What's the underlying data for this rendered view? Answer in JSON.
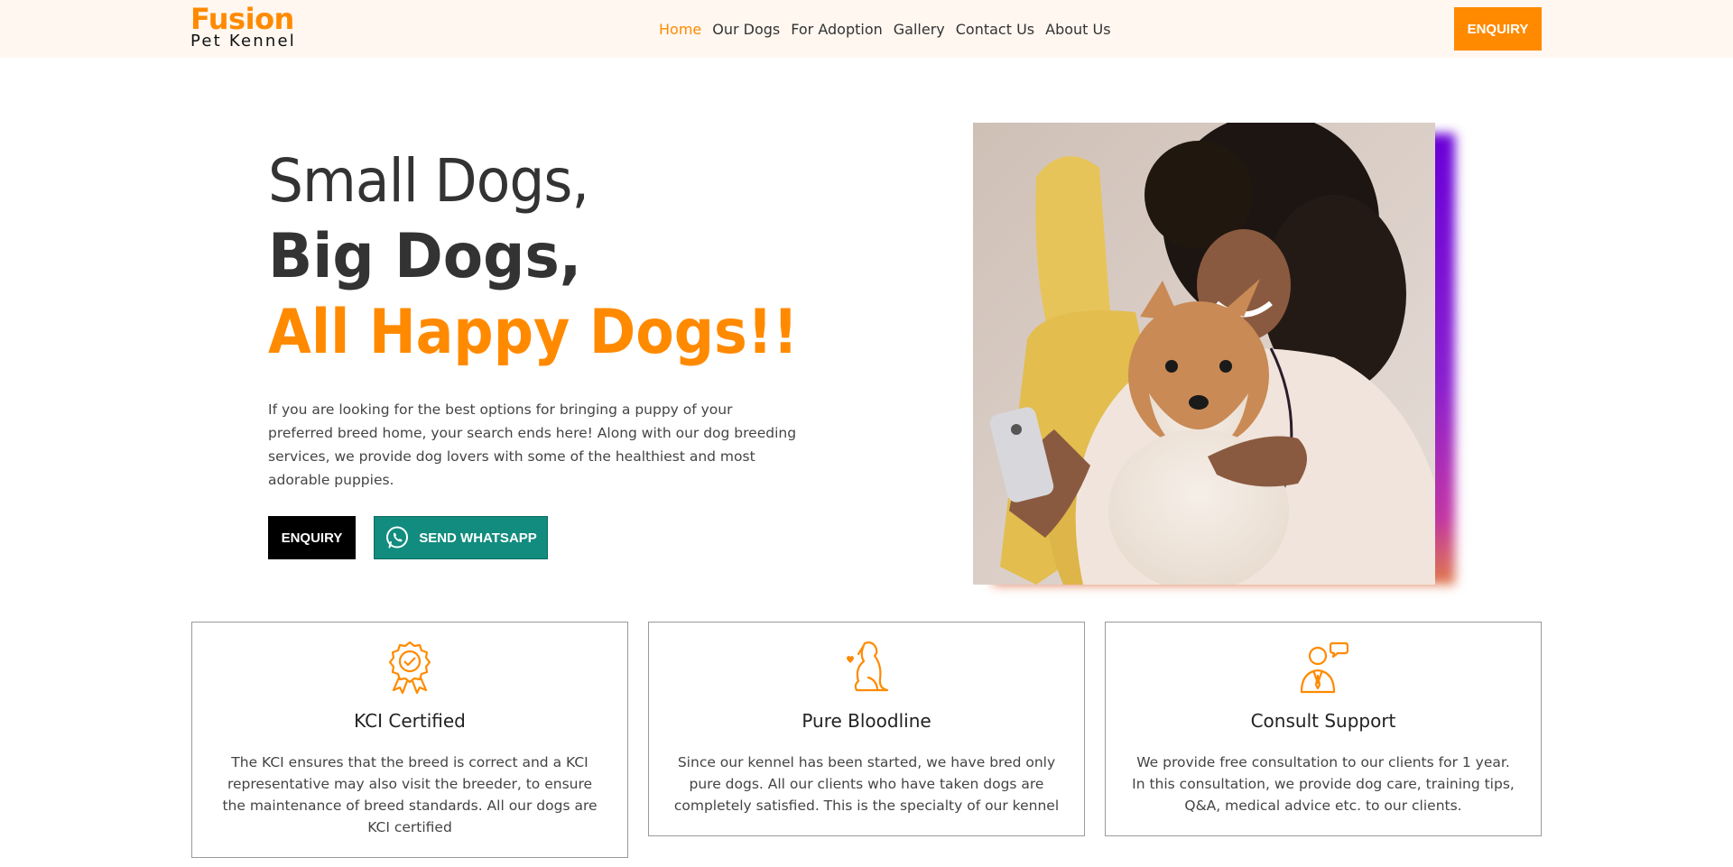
{
  "header": {
    "logo_top": "Fusion",
    "logo_bottom": "Pet Kennel",
    "nav": [
      "Home",
      "Our Dogs",
      "For Adoption",
      "Gallery",
      "Contact Us",
      "About Us"
    ],
    "active_nav": "Home",
    "enquiry_label": "ENQUIRY"
  },
  "hero": {
    "line1": "Small Dogs,",
    "line2": "Big Dogs,",
    "line3": "All Happy Dogs!!",
    "description": "If you are looking for the best options for bringing a puppy of your preferred breed home, your search ends here! Along with our dog breeding services, we provide dog lovers with some of the healthiest and most adorable puppies.",
    "enquiry_label": "ENQUIRY",
    "whatsapp_label": "SEND WHATSAPP"
  },
  "features": [
    {
      "icon": "certified-badge-icon",
      "title": "KCI Certified",
      "text": "The KCI ensures that the breed is correct and a KCI representative may also visit the breeder, to ensure the maintenance of breed standards. All our dogs are KCI certified"
    },
    {
      "icon": "dog-heart-icon",
      "title": "Pure Bloodline",
      "text": "Since our kennel has been started, we have bred only pure dogs. All our clients who have taken dogs are completely satisfied. This is the specialty of our kennel"
    },
    {
      "icon": "consultant-chat-icon",
      "title": "Consult Support",
      "text": "We provide free consultation to our clients for 1 year. In this consultation, we provide dog care, training tips, Q&A, medical advice etc. to our clients."
    }
  ],
  "colors": {
    "accent": "#ff8a00",
    "header_bg": "#fff7f0",
    "whatsapp": "#128c7e",
    "dark": "#333333"
  }
}
